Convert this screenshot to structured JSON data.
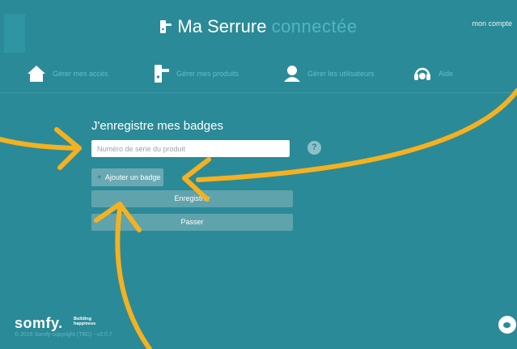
{
  "header": {
    "brand_main": "Ma Serrure",
    "brand_accent": "connectée",
    "account_link": "mon compte"
  },
  "nav": {
    "items": [
      {
        "label": "Gérer mes accès",
        "icon": "home-icon"
      },
      {
        "label": "Gérer mes produits",
        "icon": "lock-icon"
      },
      {
        "label": "Gérer les utilisateurs",
        "icon": "user-icon"
      },
      {
        "label": "Aide",
        "icon": "headset-icon"
      }
    ]
  },
  "form": {
    "title": "J'enregistre mes badges",
    "serial_placeholder": "Numéro de série du produit",
    "help_symbol": "?",
    "add_badge_plus": "+",
    "add_badge_label": "Ajouter un badge",
    "save_label": "Enregistrer",
    "skip_label": "Passer"
  },
  "footer": {
    "brand": "somfy.",
    "tagline_line1": "Building",
    "tagline_line2": "happiness",
    "copyright": "© 2016 Somfy copyright (TBD) - v2.0.7"
  },
  "colors": {
    "background": "#2b8a97",
    "accent_text": "#5fbfcc",
    "arrow": "#f5b11f"
  }
}
